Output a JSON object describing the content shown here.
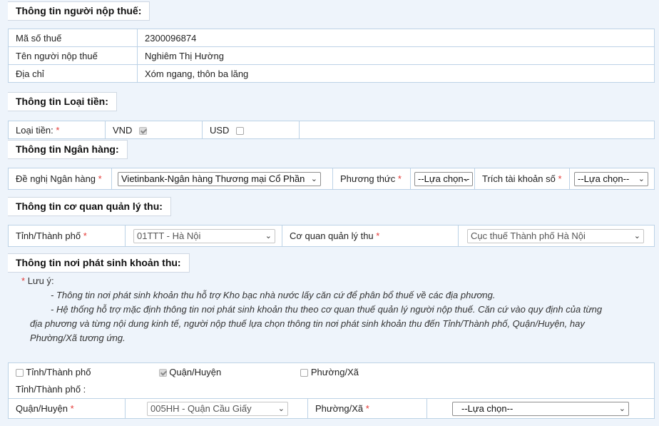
{
  "taxpayer": {
    "title": "Thông tin người nộp thuế:",
    "rows": [
      {
        "label": "Mã số thuế",
        "value": "2300096874"
      },
      {
        "label": "Tên người nộp thuế",
        "value": "Nghiêm Thị Hường"
      },
      {
        "label": "Địa chỉ",
        "value": "Xóm ngang, thôn ba lăng"
      }
    ]
  },
  "currency": {
    "title": "Thông tin Loại tiền:",
    "label": "Loại tiền:",
    "required": "*",
    "options": [
      {
        "label": "VND",
        "checked": true
      },
      {
        "label": "USD",
        "checked": false
      }
    ]
  },
  "bank": {
    "title": "Thông tin Ngân hàng:",
    "bank_label": "Đề nghị Ngân hàng",
    "bank_value": "Vietinbank-Ngân hàng Thương mại Cổ Phần",
    "method_label": "Phương thức",
    "method_value": "--Lựa chọn--",
    "account_label": "Trích tài khoản số",
    "account_value": "--Lựa chọn--",
    "required": "*"
  },
  "authority": {
    "title": "Thông tin cơ quan quản lý thu:",
    "province_label": "Tỉnh/Thành phố",
    "province_value": "01TTT - Hà Nội",
    "agency_label": "Cơ quan quản lý thu",
    "agency_value": "Cục thuế Thành phố Hà Nội",
    "required": "*"
  },
  "origin": {
    "title": "Thông tin nơi phát sinh khoản thu:",
    "note_star": "*",
    "note_title": "Lưu ý:",
    "note_line1": "- Thông tin nơi phát sinh khoản thu hỗ trợ Kho bạc nhà nước lấy căn cứ để phân bổ thuế về các địa phương.",
    "note_line2a": "- Hệ thống hỗ trợ mặc định thông tin nơi phát sinh khoản thu theo cơ quan thuế quản lý người nộp thuế. Căn cứ vào quy định của từng",
    "note_line2b": "địa phương và từng nội dung kinh tế, người nộp thuế lựa chọn thông tin nơi phát sinh khoản thu đến Tỉnh/Thành phố, Quận/Huyện, hay",
    "note_line2c": "Phường/Xã tương ứng.",
    "levels": [
      {
        "label": "Tỉnh/Thành phố",
        "checked": false
      },
      {
        "label": "Quận/Huyện",
        "checked": true
      },
      {
        "label": "Phường/Xã",
        "checked": false
      }
    ],
    "province_label": "Tỉnh/Thành phố :",
    "district_label": "Quận/Huyện",
    "district_value": "005HH - Quận Cầu Giấy",
    "ward_label": "Phường/Xã",
    "ward_value": "--Lựa chọn--",
    "required": "*"
  }
}
